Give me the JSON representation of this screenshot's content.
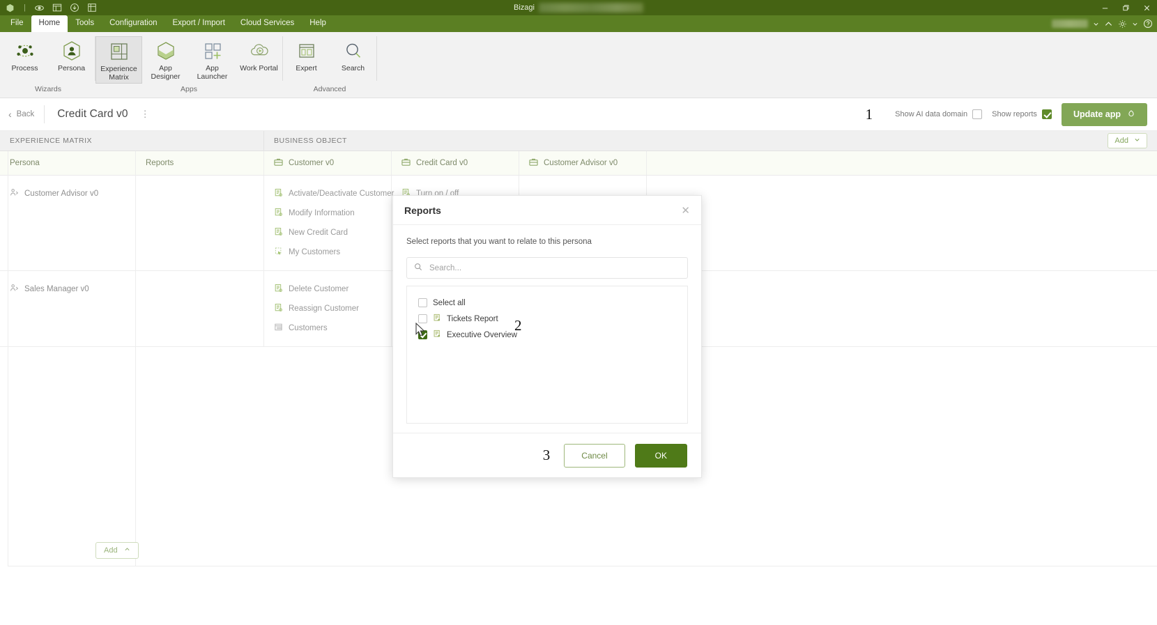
{
  "titlebar": {
    "app_name": "Bizagi",
    "quick_access": [
      "bizagi-logo-icon",
      "process-icon",
      "form-icon",
      "download-icon",
      "matrix-icon"
    ],
    "window_controls": [
      "minimize",
      "restore",
      "close"
    ]
  },
  "ribbon": {
    "tabs": [
      {
        "label": "File",
        "active": false
      },
      {
        "label": "Home",
        "active": true
      },
      {
        "label": "Tools",
        "active": false
      },
      {
        "label": "Configuration",
        "active": false
      },
      {
        "label": "Export / Import",
        "active": false
      },
      {
        "label": "Cloud Services",
        "active": false
      },
      {
        "label": "Help",
        "active": false
      }
    ],
    "groups": [
      {
        "label": "Wizards",
        "items": [
          {
            "label": "Process",
            "icon": "process-icon",
            "selected": false
          },
          {
            "label": "Persona",
            "icon": "persona-icon",
            "selected": false
          }
        ]
      },
      {
        "label": "Apps",
        "items": [
          {
            "label": "Experience Matrix",
            "icon": "experience-matrix-icon",
            "selected": true
          },
          {
            "label": "App Designer",
            "icon": "app-designer-icon",
            "selected": false
          },
          {
            "label": "App Launcher",
            "icon": "app-launcher-icon",
            "selected": false
          },
          {
            "label": "Work Portal",
            "icon": "work-portal-icon",
            "selected": false
          }
        ]
      },
      {
        "label": "Advanced",
        "items": [
          {
            "label": "Expert",
            "icon": "expert-icon",
            "selected": false
          },
          {
            "label": "Search",
            "icon": "search-icon",
            "selected": false
          }
        ]
      }
    ]
  },
  "subheader": {
    "back_label": "Back",
    "page_title": "Credit Card v0",
    "step_marker": "1",
    "show_ai_label": "Show AI data domain",
    "show_ai_checked": false,
    "show_reports_label": "Show reports",
    "show_reports_checked": true,
    "update_app_label": "Update app"
  },
  "matrix": {
    "section_experience": "EXPERIENCE MATRIX",
    "section_business_object": "BUSINESS OBJECT",
    "add_top_label": "Add",
    "add_bottom_label": "Add",
    "columns": [
      {
        "label": "Persona",
        "icon": null
      },
      {
        "label": "Reports",
        "icon": null
      },
      {
        "label": "Customer v0",
        "icon": "business-object-icon"
      },
      {
        "label": "Credit Card v0",
        "icon": "business-object-icon"
      },
      {
        "label": "Customer Advisor v0",
        "icon": "business-object-icon"
      }
    ],
    "rows": [
      {
        "persona": "Customer Advisor v0",
        "reports": [],
        "customer_v0": [
          {
            "label": "Activate/Deactivate Customer",
            "icon": "activity-icon"
          },
          {
            "label": "Modify Information",
            "icon": "activity-icon"
          },
          {
            "label": "New Credit Card",
            "icon": "activity-icon"
          },
          {
            "label": "My Customers",
            "icon": "query-icon"
          }
        ],
        "credit_card_v0": [
          {
            "label": "Turn on / off",
            "icon": "activity-icon"
          }
        ],
        "customer_advisor_v0": []
      },
      {
        "persona": "Sales Manager v0",
        "reports": [],
        "customer_v0": [
          {
            "label": "Delete Customer",
            "icon": "activity-icon"
          },
          {
            "label": "Reassign Customer",
            "icon": "activity-icon"
          },
          {
            "label": "Customers",
            "icon": "list-icon"
          }
        ],
        "credit_card_v0": [],
        "customer_advisor_v0": []
      }
    ]
  },
  "modal": {
    "title": "Reports",
    "close_icon": "close-icon",
    "subtitle": "Select reports that you want to relate to this persona",
    "search_placeholder": "Search...",
    "search_value": "",
    "select_all_label": "Select all",
    "select_all_checked": false,
    "options": [
      {
        "label": "Tickets Report",
        "checked": false,
        "icon": "report-icon"
      },
      {
        "label": "Executive Overview",
        "checked": true,
        "icon": "report-icon"
      }
    ],
    "step_marker_list": "2",
    "step_marker_footer": "3",
    "cancel_label": "Cancel",
    "ok_label": "OK"
  },
  "colors": {
    "titlebar": "#456313",
    "ribbon_tabs": "#5b7f23",
    "accent_green": "#82a756",
    "ok_green": "#4f7a18",
    "checkbox_green": "#5f8a2a"
  }
}
